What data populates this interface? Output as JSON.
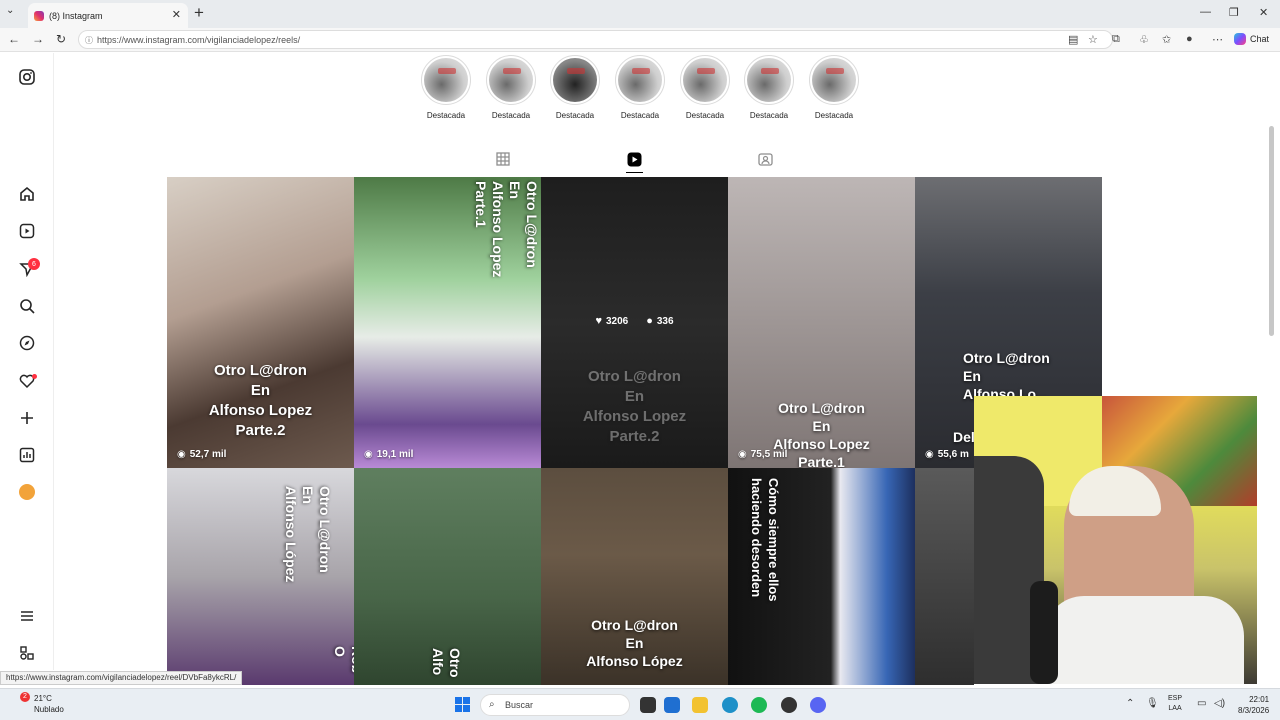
{
  "browser": {
    "tab_title": "(8) Instagram",
    "url": "https://www.instagram.com/vigilanciadelopez/reels/",
    "chat_label": "Chat",
    "status_url": "https://www.instagram.com/vigilanciadelopez/reel/DVbFa8ykcRL/"
  },
  "sidebar": {
    "notifications_badge": "6"
  },
  "highlights": [
    "Destacada",
    "Destacada",
    "Destacada",
    "Destacada",
    "Destacada",
    "Destacada",
    "Destacada"
  ],
  "reels": [
    {
      "caption": "Otro L@dron\nEn\nAlfonso Lopez\nParte.2",
      "views": "52,7 mil"
    },
    {
      "caption": "Otro L@dron\nEn\nAlfonso Lopez\nParte.1",
      "views": "19,1 mil"
    },
    {
      "caption": "Otro L@dron\nEn\nAlfonso Lopez\nParte.2",
      "likes": "3206",
      "comments": "336"
    },
    {
      "caption": "Otro L@dron\nEn\nAlfonso Lopez\nParte.1",
      "views": "75,5 mil"
    },
    {
      "caption": "Otro L@dron\nEn\nAlfonso Lo...",
      "caption_extra": "Del",
      "views": "55,6 m"
    },
    {
      "caption": "Otro L@dron\nEn\nAlfonso López",
      "extra": "CON\nRob\nO"
    },
    {
      "caption": "Otro\nAlfo"
    },
    {
      "caption": "Otro L@dron\nEn\nAlfonso López"
    },
    {
      "caption": "Cómo siempre ellos\nhaciendo desorden"
    }
  ],
  "taskbar": {
    "temperature": "21°C",
    "weather": "Nublado",
    "weather_badge": "2",
    "search_placeholder": "Buscar",
    "lang_top": "ESP",
    "lang_bottom": "LAA",
    "time": "22:01",
    "date": "8/3/2026"
  }
}
